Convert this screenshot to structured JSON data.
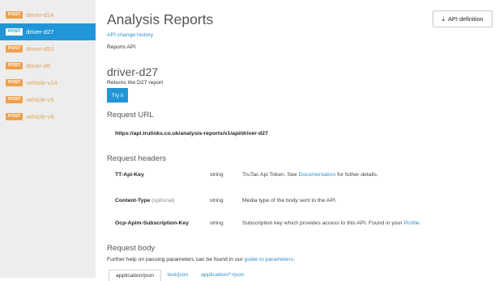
{
  "sidebar": {
    "items": [
      {
        "badge": "POST",
        "label": "driver-d14"
      },
      {
        "badge": "POST",
        "label": "driver-d27"
      },
      {
        "badge": "POST",
        "label": "driver-d53"
      },
      {
        "badge": "POST",
        "label": "driver-d6"
      },
      {
        "badge": "POST",
        "label": "vehicle-v14"
      },
      {
        "badge": "POST",
        "label": "vehicle-v5"
      },
      {
        "badge": "POST",
        "label": "vehicle-v6"
      }
    ],
    "active_index": 1
  },
  "header": {
    "title": "Analysis Reports",
    "history_link": "API change history",
    "api_name": "Reports API",
    "api_definition_label": "API definition"
  },
  "operation": {
    "title": "driver-d27",
    "description": "Returns the D27 report",
    "try_label": "Try it"
  },
  "request_url": {
    "title": "Request URL",
    "url": "https://api.trulinks.co.uk/analysis-reports/v1/api/driver-d27"
  },
  "request_headers": {
    "title": "Request headers",
    "rows": [
      {
        "name": "TT-Api-Key",
        "optional": "",
        "type": "string",
        "desc_before": "TruTac Api Token. See ",
        "link": "Documentation",
        "desc_after": " for futher details."
      },
      {
        "name": "Content-Type",
        "optional": " (optional)",
        "type": "string",
        "desc_before": "Media type of the body sent to the API.",
        "link": "",
        "desc_after": ""
      },
      {
        "name": "Ocp-Apim-Subscription-Key",
        "optional": "",
        "type": "string",
        "desc_before": "Subscription key which provides access to this API. Found in your ",
        "link": "Profile",
        "desc_after": "."
      }
    ]
  },
  "request_body": {
    "title": "Request body",
    "help_before": "Further help on passing parameters can be found in our ",
    "help_link": "guide to parameters",
    "help_after": ".",
    "tabs": [
      "application/json",
      "text/json",
      "application/*+json"
    ]
  },
  "colors": {
    "accent": "#2196d6",
    "badge": "#f0a04a",
    "link": "#2e8fd0",
    "sidebar_bg": "#ededed"
  }
}
